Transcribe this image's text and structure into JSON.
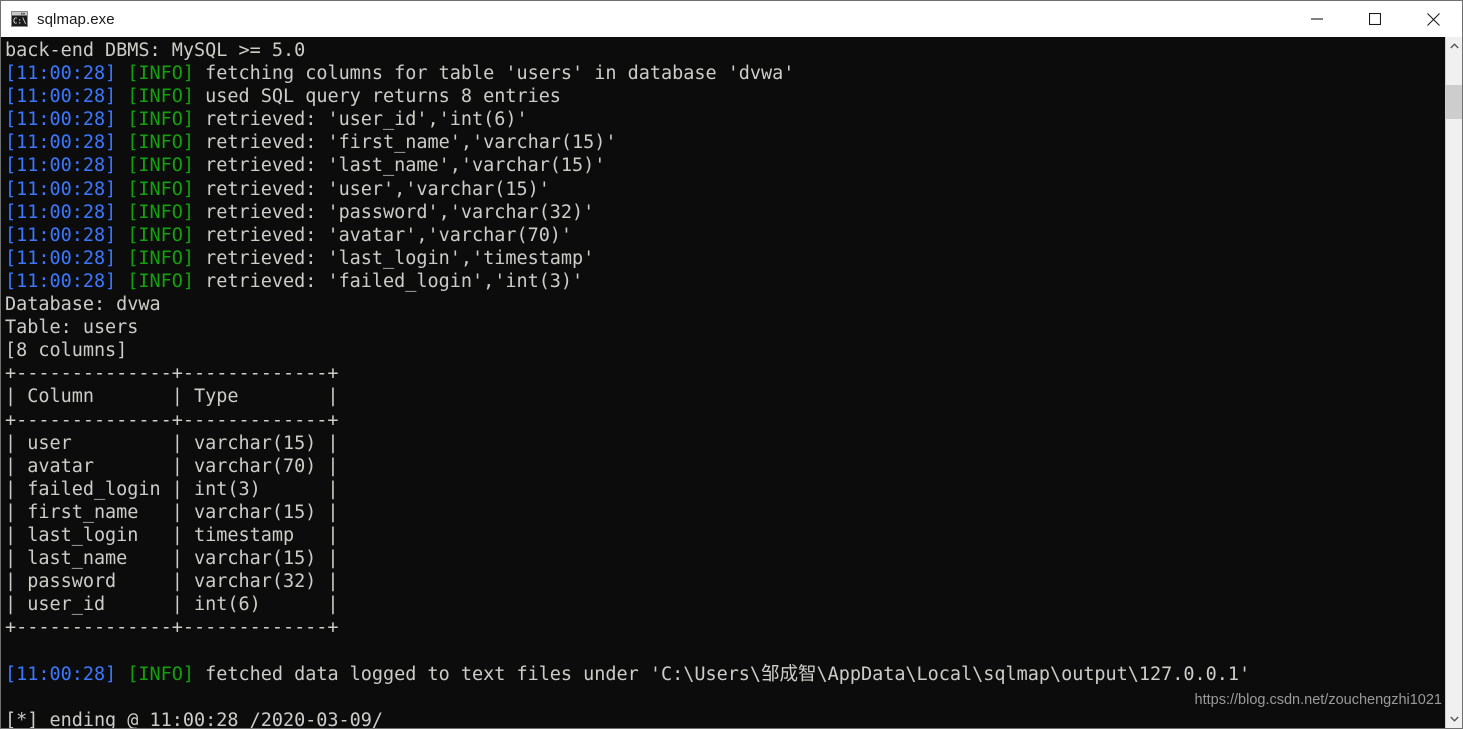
{
  "window": {
    "title": "sqlmap.exe",
    "icon": "console-icon",
    "controls": {
      "minimize": "minimize-button",
      "maximize": "maximize-button",
      "close": "close-button"
    }
  },
  "colors": {
    "terminal_bg": "#0c0c0c",
    "text": "#ccccc8",
    "timestamp": "#3b78ff",
    "info": "#13a10e",
    "titlebar_bg": "#ffffff",
    "scrollbar_track": "#f0f0f0",
    "scrollbar_thumb": "#cdcdcd"
  },
  "terminal": {
    "timestamp": "11:00:28",
    "level_info": "INFO",
    "lines": [
      {
        "type": "plain",
        "text": "back-end DBMS: MySQL >= 5.0"
      },
      {
        "type": "log",
        "time": "[11:00:28]",
        "level": "[INFO]",
        "text": " fetching columns for table 'users' in database 'dvwa'"
      },
      {
        "type": "log",
        "time": "[11:00:28]",
        "level": "[INFO]",
        "text": " used SQL query returns 8 entries"
      },
      {
        "type": "log",
        "time": "[11:00:28]",
        "level": "[INFO]",
        "text": " retrieved: 'user_id','int(6)'"
      },
      {
        "type": "log",
        "time": "[11:00:28]",
        "level": "[INFO]",
        "text": " retrieved: 'first_name','varchar(15)'"
      },
      {
        "type": "log",
        "time": "[11:00:28]",
        "level": "[INFO]",
        "text": " retrieved: 'last_name','varchar(15)'"
      },
      {
        "type": "log",
        "time": "[11:00:28]",
        "level": "[INFO]",
        "text": " retrieved: 'user','varchar(15)'"
      },
      {
        "type": "log",
        "time": "[11:00:28]",
        "level": "[INFO]",
        "text": " retrieved: 'password','varchar(32)'"
      },
      {
        "type": "log",
        "time": "[11:00:28]",
        "level": "[INFO]",
        "text": " retrieved: 'avatar','varchar(70)'"
      },
      {
        "type": "log",
        "time": "[11:00:28]",
        "level": "[INFO]",
        "text": " retrieved: 'last_login','timestamp'"
      },
      {
        "type": "log",
        "time": "[11:00:28]",
        "level": "[INFO]",
        "text": " retrieved: 'failed_login','int(3)'"
      },
      {
        "type": "plain",
        "text": "Database: dvwa"
      },
      {
        "type": "plain",
        "text": "Table: users"
      },
      {
        "type": "plain",
        "text": "[8 columns]"
      },
      {
        "type": "plain",
        "text": "+--------------+-------------+"
      },
      {
        "type": "plain",
        "text": "| Column       | Type        |"
      },
      {
        "type": "plain",
        "text": "+--------------+-------------+"
      },
      {
        "type": "plain",
        "text": "| user         | varchar(15) |"
      },
      {
        "type": "plain",
        "text": "| avatar       | varchar(70) |"
      },
      {
        "type": "plain",
        "text": "| failed_login | int(3)      |"
      },
      {
        "type": "plain",
        "text": "| first_name   | varchar(15) |"
      },
      {
        "type": "plain",
        "text": "| last_login   | timestamp   |"
      },
      {
        "type": "plain",
        "text": "| last_name    | varchar(15) |"
      },
      {
        "type": "plain",
        "text": "| password     | varchar(32) |"
      },
      {
        "type": "plain",
        "text": "| user_id      | int(6)      |"
      },
      {
        "type": "plain",
        "text": "+--------------+-------------+"
      },
      {
        "type": "blank",
        "text": " "
      },
      {
        "type": "log",
        "time": "[11:00:28]",
        "level": "[INFO]",
        "text": " fetched data logged to text files under 'C:\\Users\\邹成智\\AppData\\Local\\sqlmap\\output\\127.0.0.1'"
      },
      {
        "type": "blank",
        "text": " "
      },
      {
        "type": "plain",
        "text": "[*] ending @ 11:00:28 /2020-03-09/"
      }
    ],
    "result_table": {
      "headers": [
        "Column",
        "Type"
      ],
      "rows": [
        [
          "user",
          "varchar(15)"
        ],
        [
          "avatar",
          "varchar(70)"
        ],
        [
          "failed_login",
          "int(3)"
        ],
        [
          "first_name",
          "varchar(15)"
        ],
        [
          "last_login",
          "timestamp"
        ],
        [
          "last_name",
          "varchar(15)"
        ],
        [
          "password",
          "varchar(32)"
        ],
        [
          "user_id",
          "int(6)"
        ]
      ],
      "database": "dvwa",
      "table": "users",
      "column_count": "[8 columns]"
    },
    "output_path": "C:\\Users\\邹成智\\AppData\\Local\\sqlmap\\output\\127.0.0.1",
    "ending_time": "11:00:28",
    "ending_date": "/2020-03-09/"
  },
  "scrollbar": {
    "up_arrow": "chevron-up-icon",
    "down_arrow": "chevron-down-icon"
  },
  "watermark": {
    "text": "https://blog.csdn.net/zouchengzhi1021"
  }
}
